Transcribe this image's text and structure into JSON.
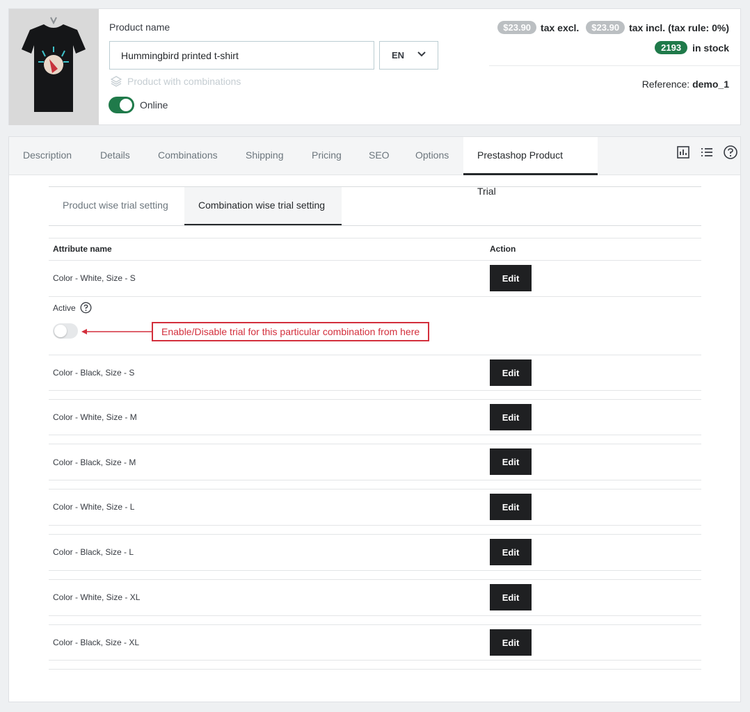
{
  "header": {
    "product_name_label": "Product name",
    "product_name_value": "Hummingbird printed t-shirt",
    "language": "EN",
    "product_with_combinations": "Product with combinations",
    "online_label": "Online",
    "price_excl": "$23.90",
    "tax_excl_label": "tax excl.",
    "price_incl": "$23.90",
    "tax_incl_label": "tax incl. (tax rule: 0%)",
    "stock_count": "2193",
    "stock_label": "in stock",
    "reference_label": "Reference:",
    "reference_value": "demo_1"
  },
  "tabs": [
    "Description",
    "Details",
    "Combinations",
    "Shipping",
    "Pricing",
    "SEO",
    "Options",
    "Prestashop Product Trial"
  ],
  "active_tab": "Prestashop Product Trial",
  "subtabs": [
    "Product wise trial setting",
    "Combination wise trial setting"
  ],
  "active_subtab": "Combination wise trial setting",
  "table": {
    "col_attribute": "Attribute name",
    "col_action": "Action",
    "edit_label": "Edit",
    "active_label": "Active",
    "callout_text": "Enable/Disable trial for this particular combination from here",
    "rows": [
      "Color - White, Size - S",
      "Color - Black, Size - S",
      "Color - White, Size - M",
      "Color - Black, Size - M",
      "Color - White, Size - L",
      "Color - Black, Size - L",
      "Color - White, Size - XL",
      "Color - Black, Size - XL"
    ]
  },
  "colors": {
    "accent_green": "#1f7a4a",
    "callout_red": "#d32f3c",
    "button_dark": "#1f2022"
  },
  "icons": [
    "layers-icon",
    "chart-icon",
    "list-icon",
    "help-icon",
    "chevron-down-icon"
  ]
}
